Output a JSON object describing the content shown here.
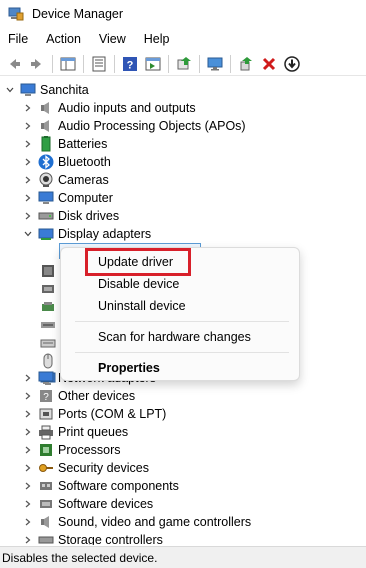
{
  "window": {
    "title": "Device Manager"
  },
  "menu": [
    "File",
    "Action",
    "View",
    "Help"
  ],
  "toolbar": {
    "icons": [
      "back-arrow-icon",
      "forward-arrow-icon",
      "show-hide-console-tree-icon",
      "properties-icon",
      "help-icon",
      "action-pane-icon",
      "update-driver-icon",
      "monitor-scan-icon",
      "enable-device-icon",
      "uninstall-device-icon",
      "disable-device-icon"
    ]
  },
  "tree": {
    "root": "Sanchita",
    "categories": [
      "Audio inputs and outputs",
      "Audio Processing Objects (APOs)",
      "Batteries",
      "Bluetooth",
      "Cameras",
      "Computer",
      "Disk drives",
      "Display adapters"
    ],
    "categories_after": [
      "Other devices",
      "Ports (COM & LPT)",
      "Print queues",
      "Processors",
      "Security devices",
      "Software components",
      "Software devices",
      "Sound, video and game controllers",
      "Storage controllers"
    ],
    "partial_row": "Network adapters"
  },
  "context_menu": {
    "items": [
      "Update driver",
      "Disable device",
      "Uninstall device",
      "Scan for hardware changes",
      "Properties"
    ]
  },
  "status": {
    "text": "Disables the selected device."
  },
  "colors": {
    "highlight": "#d8202a",
    "selection": "#5b9bd5"
  }
}
